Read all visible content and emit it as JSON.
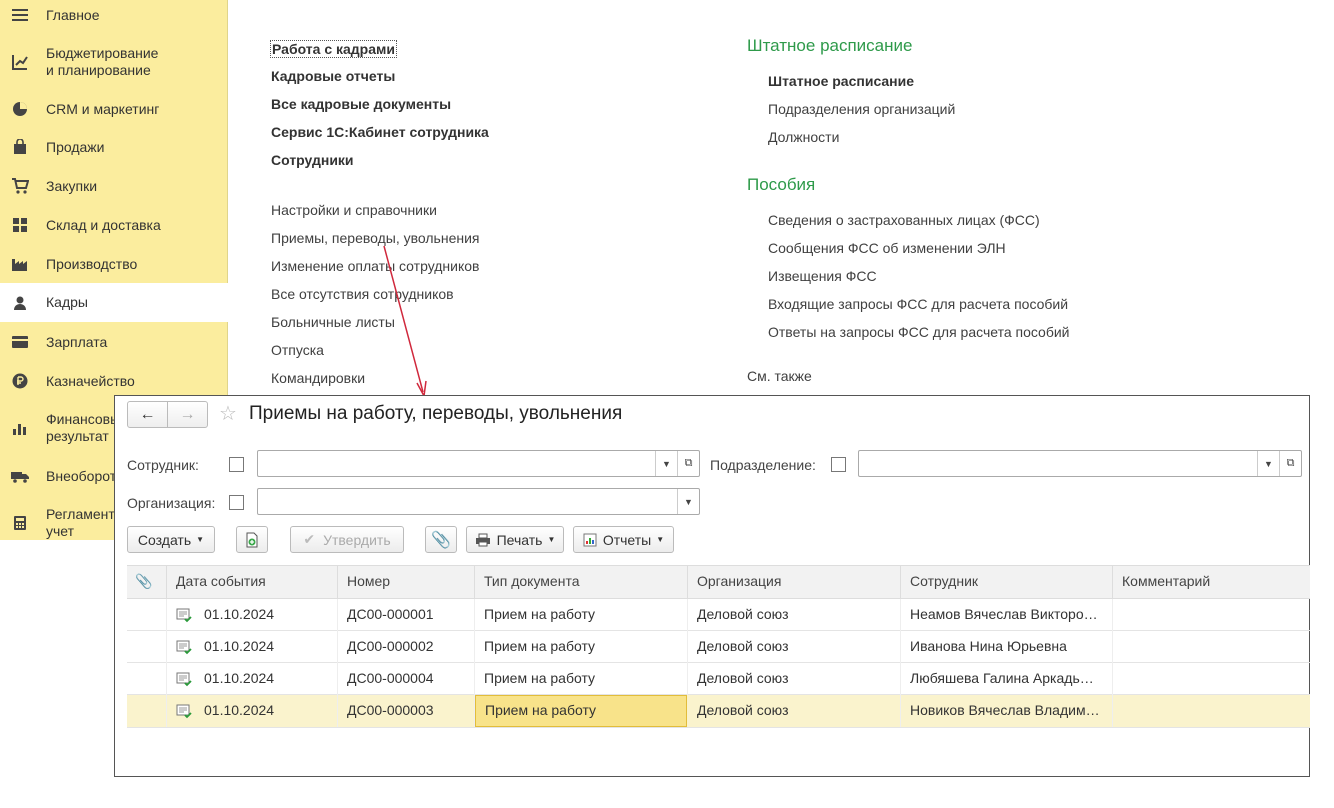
{
  "sidebar": {
    "items": [
      {
        "label": "Главное",
        "icon": "menu-lines-icon"
      },
      {
        "label": "Бюджетирование\nи планирование",
        "icon": "budget-chart-icon"
      },
      {
        "label": "CRM и маркетинг",
        "icon": "pie-icon"
      },
      {
        "label": "Продажи",
        "icon": "shopping-bag-icon"
      },
      {
        "label": "Закупки",
        "icon": "cart-icon"
      },
      {
        "label": "Склад и доставка",
        "icon": "warehouse-grid-icon"
      },
      {
        "label": "Производство",
        "icon": "factory-icon"
      },
      {
        "label": "Кадры",
        "icon": "person-icon"
      },
      {
        "label": "Зарплата",
        "icon": "card-icon"
      },
      {
        "label": "Казначейство",
        "icon": "ruble-coin-icon"
      },
      {
        "label": "Финансовый\nрезультат",
        "icon": "bar-chart-icon"
      },
      {
        "label": "Внеоборот",
        "icon": "truck-icon"
      },
      {
        "label": "Регламент\nучет",
        "icon": "calculator-icon"
      }
    ]
  },
  "menu": {
    "left_bold": [
      "Работа с кадрами",
      "Кадровые отчеты",
      "Все кадровые документы",
      "Сервис 1С:Кабинет сотрудника",
      "Сотрудники"
    ],
    "left_normal": [
      "Настройки и справочники",
      "Приемы, переводы, увольнения",
      "Изменение оплаты сотрудников",
      "Все отсутствия сотрудников",
      "Больничные листы",
      "Отпуска",
      "Командировки"
    ],
    "staff_title": "Штатное расписание",
    "staff_items": [
      "Штатное расписание",
      "Подразделения организаций",
      "Должности"
    ],
    "benefits_title": "Пособия",
    "benefits_items": [
      "Сведения о застрахованных лицах (ФСС)",
      "Сообщения ФСС об изменении ЭЛН",
      "Извещения ФСС",
      "Входящие запросы ФСС для расчета пособий",
      "Ответы на запросы ФСС для расчета пособий"
    ],
    "see_also": "См. также"
  },
  "window": {
    "title": "Приемы на работу, переводы, увольнения",
    "filters": {
      "employee_label": "Сотрудник:",
      "department_label": "Подразделение:",
      "organization_label": "Организация:"
    },
    "toolbar": {
      "create": "Создать",
      "approve": "Утвердить",
      "print": "Печать",
      "reports": "Отчеты"
    },
    "columns": [
      "Дата события",
      "Номер",
      "Тип документа",
      "Организация",
      "Сотрудник",
      "Комментарий"
    ],
    "rows": [
      {
        "date": "01.10.2024",
        "number": "ДС00-000001",
        "type": "Прием на работу",
        "org": "Деловой союз",
        "employee": "Неамов Вячеслав Викторо…",
        "comment": ""
      },
      {
        "date": "01.10.2024",
        "number": "ДС00-000002",
        "type": "Прием на работу",
        "org": "Деловой союз",
        "employee": "Иванова Нина Юрьевна",
        "comment": ""
      },
      {
        "date": "01.10.2024",
        "number": "ДС00-000004",
        "type": "Прием на работу",
        "org": "Деловой союз",
        "employee": "Любяшева Галина Аркадь…",
        "comment": ""
      },
      {
        "date": "01.10.2024",
        "number": "ДС00-000003",
        "type": "Прием на работу",
        "org": "Деловой союз",
        "employee": "Новиков Вячеслав Владим…",
        "comment": ""
      }
    ]
  },
  "colors": {
    "sidebar_bg": "#fbed9e",
    "section_green": "#2e9a4a",
    "arrow_red": "#d0283c",
    "selected_row": "#faf3cd"
  }
}
